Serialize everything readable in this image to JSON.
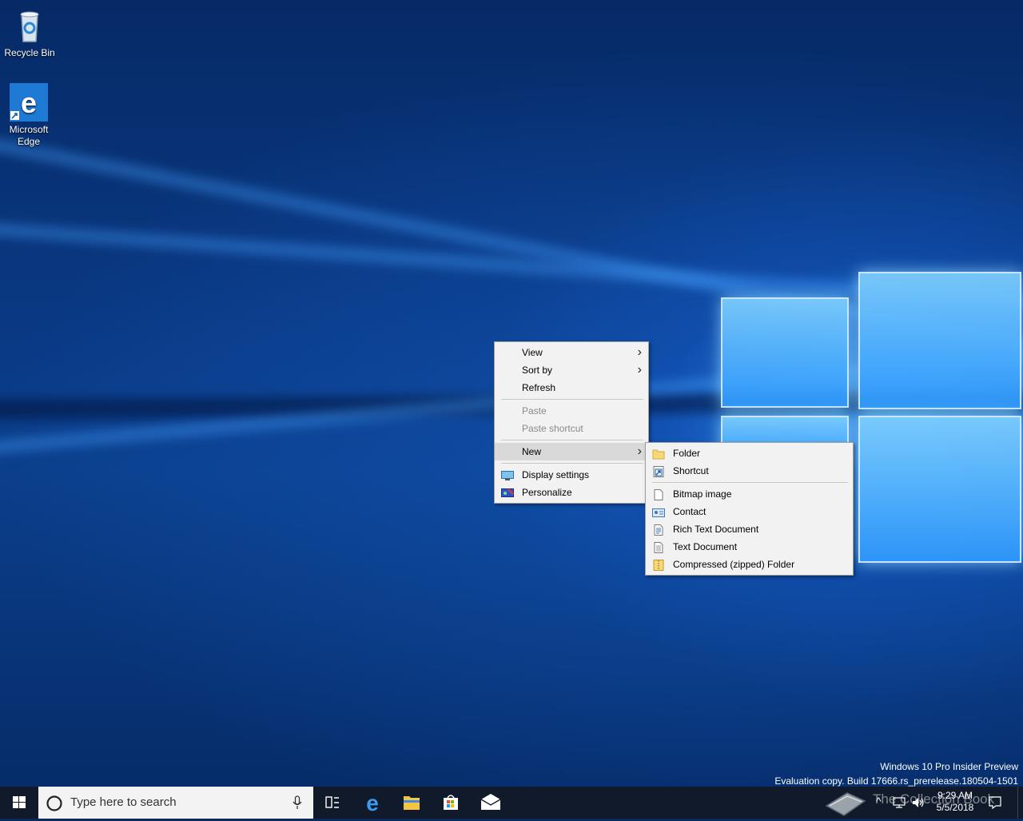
{
  "desktop": {
    "icons": [
      {
        "label": "Recycle Bin",
        "icon": "recycle-bin-icon"
      },
      {
        "label": "Microsoft Edge",
        "icon": "edge-icon"
      }
    ]
  },
  "context_menu": {
    "items": [
      {
        "label": "View",
        "submenu": true
      },
      {
        "label": "Sort by",
        "submenu": true
      },
      {
        "label": "Refresh"
      },
      {
        "label": "Paste",
        "disabled": true
      },
      {
        "label": "Paste shortcut",
        "disabled": true
      },
      {
        "label": "New",
        "submenu": true,
        "highlighted": true
      },
      {
        "label": "Display settings",
        "icon": "display-settings-icon"
      },
      {
        "label": "Personalize",
        "icon": "personalize-icon"
      }
    ]
  },
  "new_submenu": {
    "items": [
      {
        "label": "Folder",
        "icon": "folder-icon"
      },
      {
        "label": "Shortcut",
        "icon": "shortcut-icon"
      },
      {
        "label": "Bitmap image",
        "icon": "bitmap-file-icon"
      },
      {
        "label": "Contact",
        "icon": "contact-icon"
      },
      {
        "label": "Rich Text Document",
        "icon": "rich-text-file-icon"
      },
      {
        "label": "Text Document",
        "icon": "text-file-icon"
      },
      {
        "label": "Compressed (zipped) Folder",
        "icon": "zip-folder-icon"
      }
    ]
  },
  "watermark": {
    "line1": "Windows 10 Pro Insider Preview",
    "line2": "Evaluation copy. Build 17666.rs_prerelease.180504-1501"
  },
  "taskbar": {
    "search_placeholder": "Type here to search",
    "pinned": [
      "task-view-icon",
      "edge-icon",
      "file-explorer-icon",
      "store-icon",
      "mail-icon"
    ],
    "clock_time": "9:29 AM",
    "clock_date": "5/5/2018"
  },
  "overlay_watermark": "The Collection Book",
  "colors": {
    "menu_bg": "#f2f2f2",
    "menu_highlight": "#d9d9d9",
    "taskbar_bg": "#101a2a",
    "accent": "#0078d7"
  }
}
